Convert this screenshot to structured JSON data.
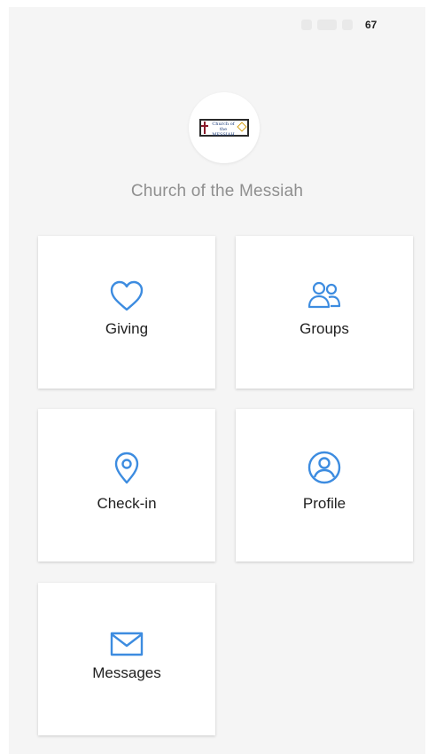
{
  "status_bar": {
    "battery": "67"
  },
  "organization": {
    "name": "Church of the Messiah",
    "logo_text": "Church of the MESSIAH"
  },
  "tiles": [
    {
      "label": "Giving",
      "icon": "heart-icon"
    },
    {
      "label": "Groups",
      "icon": "groups-icon"
    },
    {
      "label": "Check-in",
      "icon": "location-pin-icon"
    },
    {
      "label": "Profile",
      "icon": "user-circle-icon"
    },
    {
      "label": "Messages",
      "icon": "envelope-icon"
    }
  ],
  "colors": {
    "accent": "#3d8ce0",
    "background": "#f5f5f5",
    "tile": "#ffffff",
    "text": "#1f1f1f",
    "subtitle": "#8f8f8f"
  }
}
